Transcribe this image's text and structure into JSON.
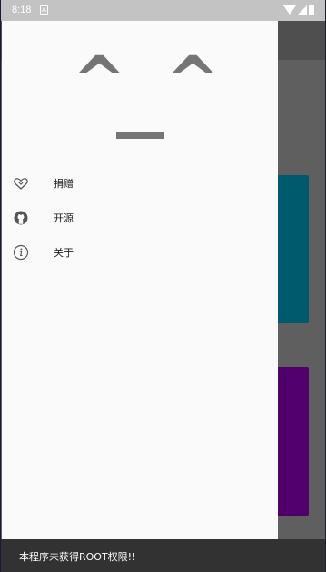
{
  "status_bar": {
    "time": "8:18",
    "notification_glyph": "A",
    "icons": [
      "wifi-icon",
      "signal-icon",
      "battery-icon"
    ]
  },
  "drawer": {
    "face": {
      "left_eye": "^",
      "right_eye": "^"
    },
    "menu": [
      {
        "label": "捐赠",
        "icon": "heart-icon"
      },
      {
        "label": "开源",
        "icon": "github-icon"
      },
      {
        "label": "关于",
        "icon": "info-icon"
      }
    ]
  },
  "background": {
    "colors": {
      "teal_card": "#005a6e",
      "purple_card": "#4f006b"
    }
  },
  "snackbar": {
    "message": "本程序未获得ROOT权限!!"
  }
}
